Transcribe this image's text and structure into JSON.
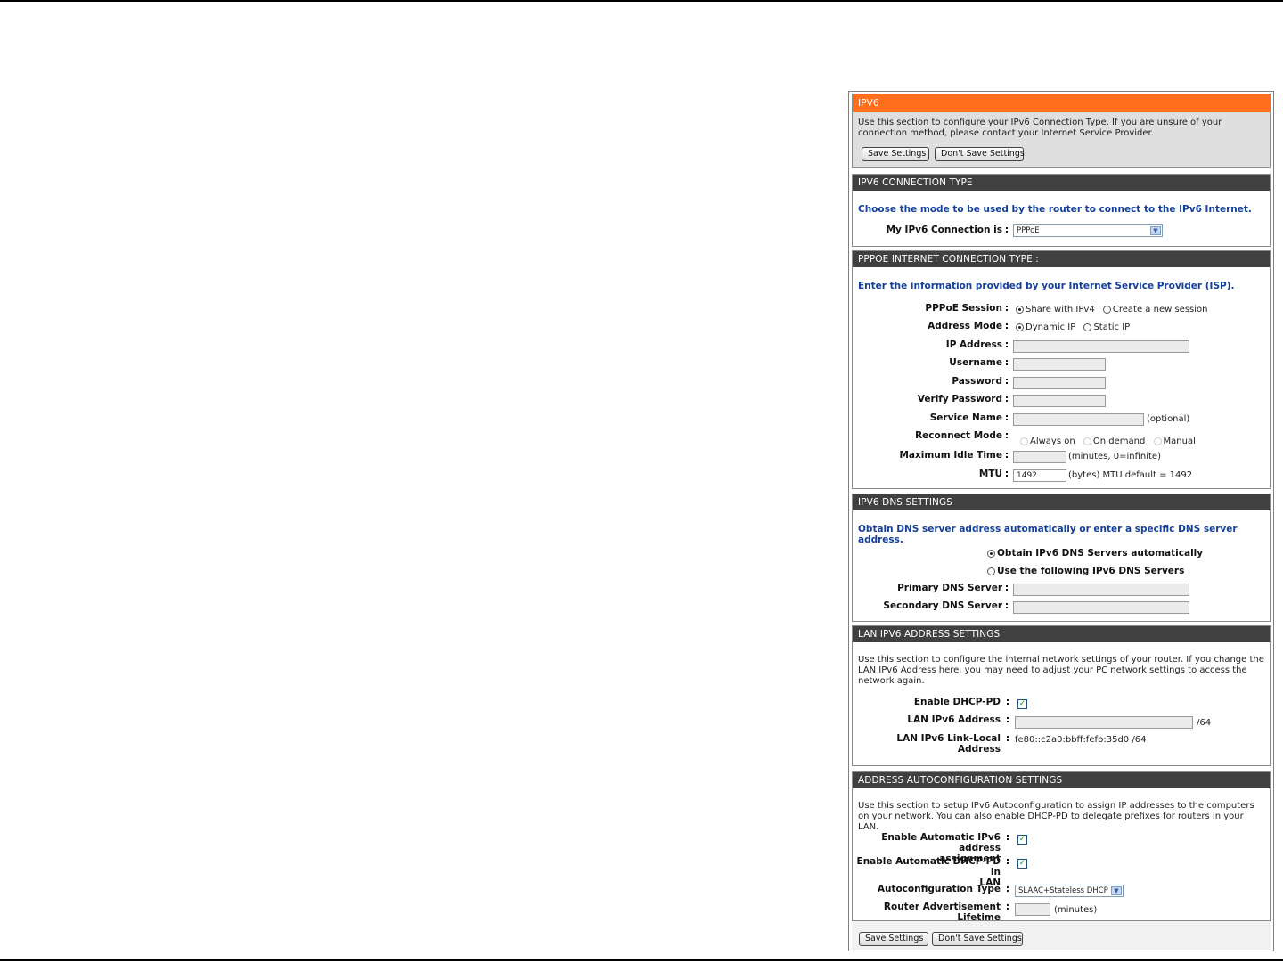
{
  "intro": {
    "header": "IPV6",
    "description": "Use this section to configure your IPv6 Connection Type. If you are unsure of your connection method, please contact your Internet Service Provider.",
    "save_label": "Save Settings",
    "dont_save_label": "Don't Save Settings"
  },
  "connection_type": {
    "header": "IPV6 CONNECTION TYPE",
    "instruction": "Choose the mode to be used by the router to connect to the IPv6 Internet.",
    "label": "My IPv6 Connection is",
    "value": "PPPoE"
  },
  "pppoe": {
    "header": "PPPOE INTERNET CONNECTION TYPE :",
    "instruction": "Enter the information provided by your Internet Service Provider (ISP).",
    "session_label": "PPPoE Session",
    "session_options": [
      "Share with IPv4",
      "Create a new session"
    ],
    "address_mode_label": "Address Mode",
    "address_mode_options": [
      "Dynamic IP",
      "Static IP"
    ],
    "ip_address_label": "IP Address",
    "username_label": "Username",
    "password_label": "Password",
    "verify_password_label": "Verify Password",
    "service_name_label": "Service Name",
    "service_name_hint": "(optional)",
    "reconnect_label": "Reconnect Mode",
    "reconnect_options": [
      "Always on",
      "On demand",
      "Manual"
    ],
    "idle_label": "Maximum Idle Time",
    "idle_hint": "(minutes, 0=infinite)",
    "mtu_label": "MTU",
    "mtu_value": "1492",
    "mtu_hint": "(bytes) MTU default = 1492"
  },
  "dns": {
    "header": "IPV6 DNS SETTINGS",
    "instruction": "Obtain DNS server address automatically or enter a specific DNS server address.",
    "auto_option": "Obtain IPv6 DNS Servers automatically",
    "manual_option": "Use the following IPv6 DNS Servers",
    "primary_label": "Primary DNS Server",
    "secondary_label": "Secondary DNS Server"
  },
  "lan": {
    "header": "LAN IPV6 ADDRESS SETTINGS",
    "description": "Use this section to configure the internal network settings of your router. If you change the LAN IPv6 Address here, you may need to adjust your PC network settings to access the network again.",
    "dhcp_pd_label": "Enable DHCP-PD",
    "address_label": "LAN IPv6 Address",
    "address_suffix": "/64",
    "link_local_label": "LAN IPv6 Link-Local Address",
    "link_local_value": "fe80::c2a0:bbff:fefb:35d0 /64"
  },
  "autoconfig": {
    "header": "ADDRESS AUTOCONFIGURATION SETTINGS",
    "description": "Use this section to setup IPv6 Autoconfiguration to assign IP addresses to the computers on your network. You can also enable DHCP-PD to delegate prefixes for routers in your LAN.",
    "auto_assign_label_1": "Enable Automatic IPv6 address",
    "auto_assign_label_2": "assignment",
    "auto_dhcp_label_1": "Enable Automatic DHCP-PD in",
    "auto_dhcp_label_2": "LAN",
    "type_label": "Autoconfiguration Type",
    "type_value": "SLAAC+Stateless DHCP",
    "lifetime_label": "Router Advertisement Lifetime",
    "lifetime_hint": "(minutes)"
  },
  "footer": {
    "save_label": "Save Settings",
    "dont_save_label": "Don't Save Settings"
  },
  "colors": {
    "orange_header": "#ff6f1e",
    "dark_header": "#404040",
    "blue_text": "#14409b"
  }
}
